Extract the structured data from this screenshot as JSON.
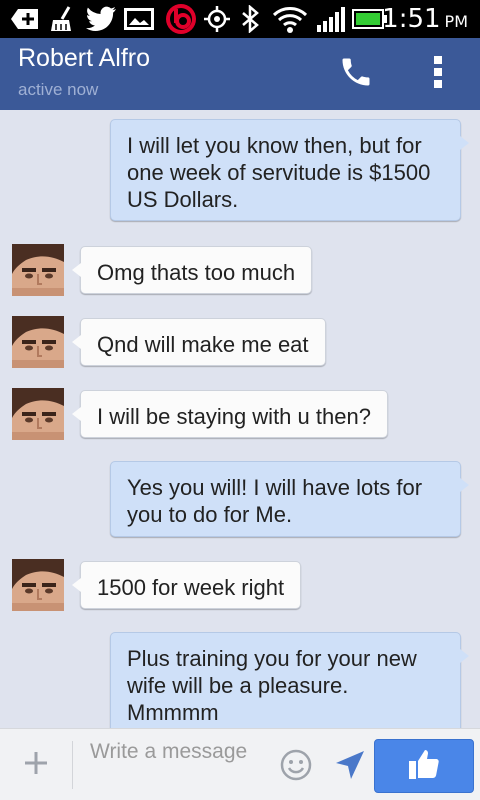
{
  "status_bar": {
    "time": "1:51",
    "ampm": "PM",
    "icons": [
      "message-add-icon",
      "cleaner-icon",
      "twitter-icon",
      "gallery-icon",
      "beats-icon",
      "gps-icon",
      "bluetooth-icon",
      "wifi-icon",
      "signal-icon",
      "battery-icon"
    ]
  },
  "header": {
    "contact_name": "Robert Alfro",
    "presence": "active now",
    "icons": [
      "phone-icon",
      "more-vertical-icon"
    ]
  },
  "messages": [
    {
      "direction": "outgoing",
      "text": "I will let you know then, but for one week of servitude is $1500 US Dollars."
    },
    {
      "direction": "incoming",
      "text": "Omg thats too much"
    },
    {
      "direction": "incoming",
      "text": "Qnd will make me eat"
    },
    {
      "direction": "incoming",
      "text": "I will be staying with u then?"
    },
    {
      "direction": "outgoing",
      "text": "Yes you will! I will have lots for you to do for Me."
    },
    {
      "direction": "incoming",
      "text": "1500 for week right"
    },
    {
      "direction": "outgoing",
      "text": "Plus training you for your new wife will be a pleasure. Mmmmm"
    }
  ],
  "composer": {
    "placeholder": "Write a message",
    "icons": [
      "plus-icon",
      "emoji-icon",
      "send-location-icon",
      "thumbs-up-icon"
    ]
  },
  "colors": {
    "header_bg": "#3b5998",
    "chat_bg": "#dfe3ee",
    "outgoing_bubble": "#cfe0f8",
    "incoming_bubble": "#fbfbfb",
    "like_button": "#4a86e8"
  }
}
